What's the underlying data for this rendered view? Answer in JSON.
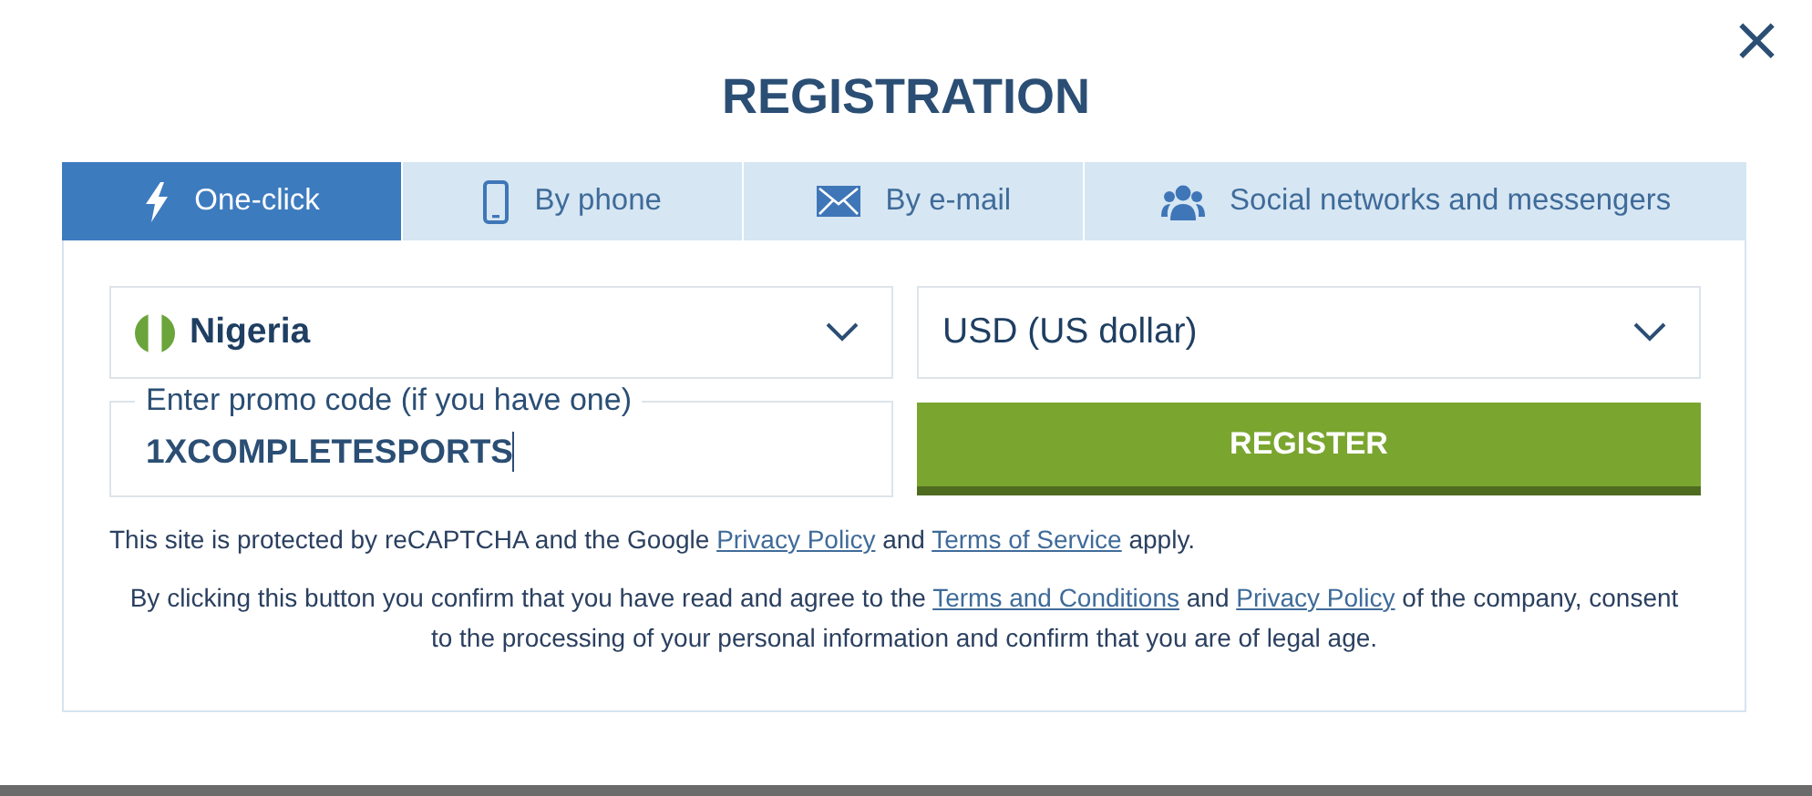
{
  "dialog": {
    "title": "REGISTRATION",
    "close": "×"
  },
  "tabs": [
    {
      "label": "One-click",
      "selected": true
    },
    {
      "label": "By phone",
      "selected": false
    },
    {
      "label": "By e-mail",
      "selected": false
    },
    {
      "label": "Social networks and messengers",
      "selected": false
    }
  ],
  "country": {
    "value": "Nigeria"
  },
  "currency": {
    "value": "USD (US dollar)"
  },
  "promo": {
    "placeholder": "Enter promo code (if you have one)",
    "value": "1XCOMPLETESPORTS"
  },
  "register_button": "REGISTER",
  "recaptcha_notice": [
    {
      "kind": "text",
      "text": "This site is protected by reCAPTCHA and the Google"
    },
    {
      "kind": "link",
      "text": "Privacy Policy"
    },
    {
      "kind": "text",
      "text": "and"
    },
    {
      "kind": "link",
      "text": "Terms of Service"
    },
    {
      "kind": "text",
      "text": "apply."
    }
  ],
  "consent_notice": [
    {
      "kind": "text",
      "text": "By clicking this button you confirm that you have read and agree to the"
    },
    {
      "kind": "link",
      "text": "Terms and Conditions"
    },
    {
      "kind": "text",
      "text": "and"
    },
    {
      "kind": "link",
      "text": "Privacy Policy"
    },
    {
      "kind": "text",
      "text": "of the company, consent to the processing of your personal information and confirm that you are of legal age."
    }
  ]
}
